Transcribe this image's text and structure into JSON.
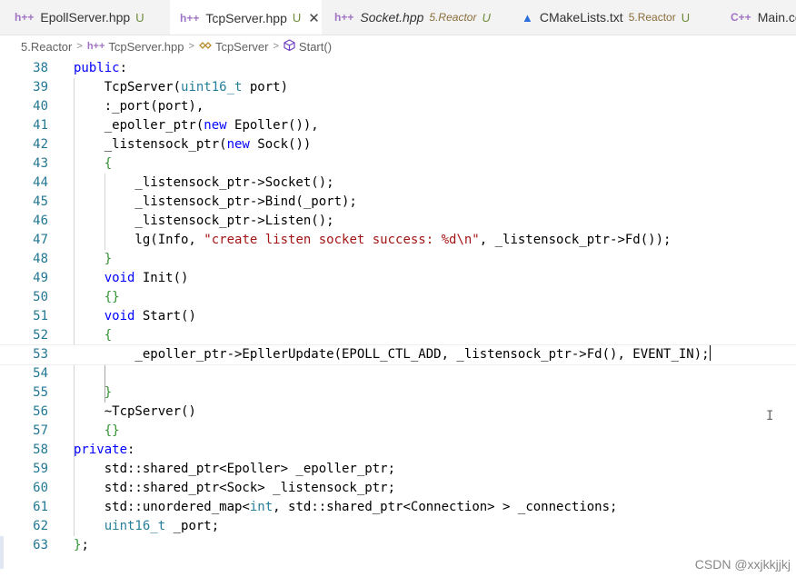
{
  "tabs": [
    {
      "icon": "h++",
      "name": "EpollServer.hpp",
      "status": "U",
      "dir": ""
    },
    {
      "icon": "h++",
      "name": "TcpServer.hpp",
      "status": "U",
      "dir": "",
      "close": "✕"
    },
    {
      "icon": "h++",
      "name": "Socket.hpp",
      "status": "U",
      "dir": "5.Reactor"
    },
    {
      "icon": "▲",
      "name": "CMakeLists.txt",
      "status": "U",
      "dir": "5.Reactor"
    },
    {
      "icon": "C++",
      "name": "Main.cc",
      "status": "",
      "dir": ""
    }
  ],
  "breadcrumb": {
    "folder": "5.Reactor",
    "file_icon": "h++",
    "file": "TcpServer.hpp",
    "class_name": "TcpServer",
    "method": "Start()",
    "sep": ">"
  },
  "code_lines": [
    {
      "n": "38",
      "t": "public:"
    },
    {
      "n": "39",
      "t": "    TcpServer(uint16_t port)"
    },
    {
      "n": "40",
      "t": "    :_port(port),"
    },
    {
      "n": "41",
      "t": "    _epoller_ptr(new Epoller()),"
    },
    {
      "n": "42",
      "t": "    _listensock_ptr(new Sock())"
    },
    {
      "n": "43",
      "t": "    {"
    },
    {
      "n": "44",
      "t": "        _listensock_ptr->Socket();"
    },
    {
      "n": "45",
      "t": "        _listensock_ptr->Bind(_port);"
    },
    {
      "n": "46",
      "t": "        _listensock_ptr->Listen();"
    },
    {
      "n": "47",
      "t": "        lg(Info, \"create listen socket success: %d\\n\", _listensock_ptr->Fd());"
    },
    {
      "n": "48",
      "t": "    }"
    },
    {
      "n": "49",
      "t": "    void Init()"
    },
    {
      "n": "50",
      "t": "    {}"
    },
    {
      "n": "51",
      "t": "    void Start()"
    },
    {
      "n": "52",
      "t": "    {"
    },
    {
      "n": "53",
      "t": "        _epoller_ptr->EpllerUpdate(EPOLL_CTL_ADD, _listensock_ptr->Fd(), EVENT_IN);"
    },
    {
      "n": "54",
      "t": ""
    },
    {
      "n": "55",
      "t": "    }"
    },
    {
      "n": "56",
      "t": "    ~TcpServer()"
    },
    {
      "n": "57",
      "t": "    {}"
    },
    {
      "n": "58",
      "t": "private:"
    },
    {
      "n": "59",
      "t": "    std::shared_ptr<Epoller> _epoller_ptr;"
    },
    {
      "n": "60",
      "t": "    std::shared_ptr<Sock> _listensock_ptr;"
    },
    {
      "n": "61",
      "t": "    std::unordered_map<int, std::shared_ptr<Connection> > _connections;"
    },
    {
      "n": "62",
      "t": "    uint16_t _port;"
    },
    {
      "n": "63",
      "t": "};"
    }
  ],
  "cursor_line": "53",
  "mouse_glyph": "I",
  "watermark": "CSDN @xxjkkjjkj",
  "colors": {
    "keyword": "#0000ff",
    "type": "#267f99",
    "string": "#a31515",
    "bracket": "#319331",
    "line_number": "#237893"
  }
}
